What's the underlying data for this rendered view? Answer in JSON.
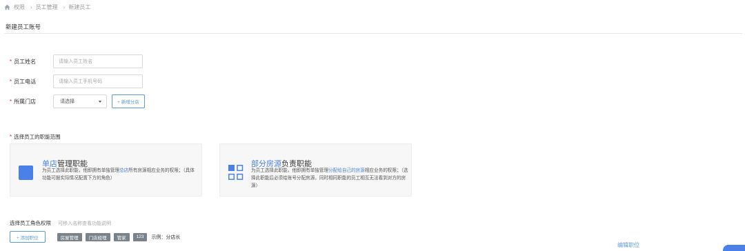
{
  "breadcrumb": {
    "items": [
      "权限",
      "员工管理",
      "新建员工"
    ]
  },
  "page": {
    "title": "新建员工账号"
  },
  "form": {
    "name": {
      "label": "员工姓名",
      "placeholder": "请输入员工姓名",
      "required_mark": "*"
    },
    "phone": {
      "label": "员工电话",
      "placeholder": "请输入员工手机号码",
      "required_mark": "*"
    },
    "store": {
      "label": "所属门店",
      "selected": "请选择",
      "add_store_label": "+ 新增分店",
      "required_mark": "*"
    }
  },
  "scope": {
    "required_mark": "*",
    "label": "选择员工的职能范围",
    "cards": [
      {
        "title_highlight": "单店",
        "title_rest": "管理职能",
        "desc_pre": "为员工选择此职能，他即拥有单独管理",
        "desc_highlight": "总店",
        "desc_post": "所有房源相应业务的权限；（具体功能可据实际情况配置下方的角色）"
      },
      {
        "title_highlight": "部分房源",
        "title_rest": "负责职能",
        "desc_pre": "为员工选择此职能，他即拥有单独管理",
        "desc_highlight": "分配给自己的房源",
        "desc_post": "相应业务的权限；（选择此职能后必须给账号分配房源，同时相同职能的员工相互无法看到对方的房源）"
      }
    ]
  },
  "roles": {
    "title": "选择员工角色权限",
    "hint": "可移入名称查看功能说明",
    "add_label": "+ 添加职位",
    "tags": [
      "房屋管理",
      "门店经理",
      "管家",
      "123"
    ],
    "example": "示例：分店长",
    "edit_label": "编辑职位"
  },
  "colors": {
    "accent": "#4a80e8",
    "link": "#5b9bd5",
    "required": "#f5222d",
    "tag_bg": "#7a828c"
  },
  "icons": {
    "home": "home-icon",
    "single_store": "square-icon",
    "partial_rooms": "grid-icon",
    "select_caret": "caret-down-icon"
  }
}
